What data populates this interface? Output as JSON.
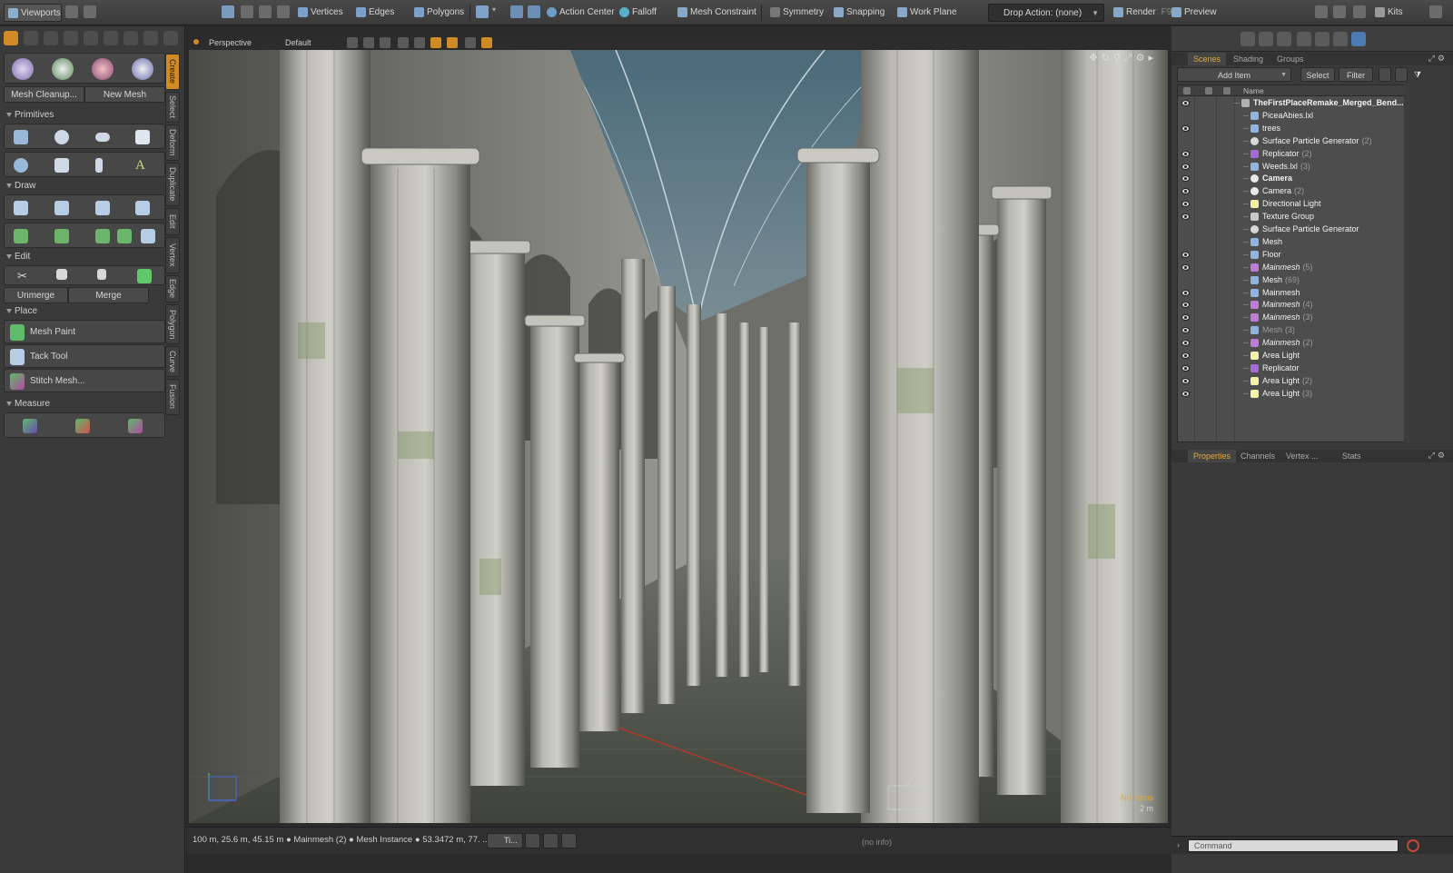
{
  "topbar": {
    "viewports_label": "Viewports",
    "vertices_label": "Vertices",
    "edges_label": "Edges",
    "polygons_label": "Polygons",
    "action_center_label": "Action Center",
    "falloff_label": "Falloff",
    "mesh_constraint_label": "Mesh Constraint",
    "symmetry_label": "Symmetry",
    "snapping_label": "Snapping",
    "work_plane_label": "Work Plane",
    "drop_action_label": "Drop Action: (none)",
    "render_label": "Render",
    "render_shortcut": "F9",
    "preview_label": "Preview",
    "kits_label": "Kits"
  },
  "toolbox": {
    "mesh_cleanup": "Mesh Cleanup...",
    "new_mesh": "New Mesh",
    "sections": {
      "primitives": "Primitives",
      "draw": "Draw",
      "edit": "Edit",
      "place": "Place",
      "measure": "Measure"
    },
    "unmerge": "Unmerge",
    "merge": "Merge",
    "place_tools": [
      "Mesh Paint",
      "Tack Tool",
      "Stitch Mesh..."
    ],
    "side_tabs": [
      "Create",
      "Select",
      "Deform",
      "Duplicate",
      "Edit",
      "Vertex",
      "Edge",
      "Polygon",
      "Curve",
      "Fusion"
    ]
  },
  "viewport": {
    "projection": "Perspective",
    "style": "Default",
    "info_items": "No Items",
    "scale": "2 m"
  },
  "status": {
    "text": "100 m, 25.6 m, 45.15 m ● Mainmesh (2) ● Mesh Instance ● 53.3472 m, 77. ...",
    "timeline_label": "Ti...",
    "no_info": "(no info)"
  },
  "scenes": {
    "tabs": [
      "Scenes",
      "Shading",
      "Groups"
    ],
    "add_item": "Add Item",
    "select": "Select",
    "filter": "Filter",
    "col_name": "Name",
    "items": [
      {
        "label": "TheFirstPlaceRemake_Merged_Bend...",
        "count": "",
        "icon": "scene",
        "style": "bold",
        "level": 0,
        "visible": true
      },
      {
        "label": "PiceaAbies.lxl",
        "count": "",
        "icon": "mesh",
        "style": "normal",
        "level": 1,
        "visible": false
      },
      {
        "label": "trees",
        "count": "",
        "icon": "mesh",
        "style": "normal",
        "level": 1,
        "visible": true
      },
      {
        "label": "Surface Particle Generator",
        "count": "(2)",
        "icon": "gen",
        "style": "normal",
        "level": 1,
        "visible": false
      },
      {
        "label": "Replicator",
        "count": "(2)",
        "icon": "rep",
        "style": "normal",
        "level": 1,
        "visible": true
      },
      {
        "label": "Weeds.lxl",
        "count": "(3)",
        "icon": "mesh",
        "style": "normal",
        "level": 1,
        "visible": true
      },
      {
        "label": "Camera",
        "count": "",
        "icon": "cam",
        "style": "bold",
        "level": 1,
        "visible": true
      },
      {
        "label": "Camera",
        "count": "(2)",
        "icon": "cam",
        "style": "normal",
        "level": 1,
        "visible": true
      },
      {
        "label": "Directional Light",
        "count": "",
        "icon": "dlight",
        "style": "normal",
        "level": 1,
        "visible": true
      },
      {
        "label": "Texture Group",
        "count": "",
        "icon": "tex",
        "style": "normal",
        "level": 1,
        "visible": true
      },
      {
        "label": "Surface Particle Generator",
        "count": "",
        "icon": "gen",
        "style": "normal",
        "level": 1,
        "visible": false
      },
      {
        "label": "Mesh",
        "count": "",
        "icon": "mesh",
        "style": "normal",
        "level": 1,
        "visible": false
      },
      {
        "label": "Floor",
        "count": "",
        "icon": "mesh",
        "style": "normal",
        "level": 1,
        "visible": true
      },
      {
        "label": "Mainmesh",
        "count": "(5)",
        "icon": "inst",
        "style": "italic",
        "level": 1,
        "visible": true
      },
      {
        "label": "Mesh",
        "count": "(69)",
        "icon": "mesh",
        "style": "normal",
        "level": 1,
        "visible": false
      },
      {
        "label": "Mainmesh",
        "count": "",
        "icon": "mesh",
        "style": "normal",
        "level": 1,
        "visible": true
      },
      {
        "label": "Mainmesh",
        "count": "(4)",
        "icon": "inst",
        "style": "italic",
        "level": 1,
        "visible": true
      },
      {
        "label": "Mainmesh",
        "count": "(3)",
        "icon": "inst",
        "style": "italic",
        "level": 1,
        "visible": true
      },
      {
        "label": "Mesh",
        "count": "(3)",
        "icon": "mesh",
        "style": "dim",
        "level": 1,
        "visible": true
      },
      {
        "label": "Mainmesh",
        "count": "(2)",
        "icon": "inst",
        "style": "italic",
        "level": 1,
        "visible": true
      },
      {
        "label": "Area Light",
        "count": "",
        "icon": "alight",
        "style": "normal",
        "level": 1,
        "visible": true
      },
      {
        "label": "Replicator",
        "count": "",
        "icon": "rep",
        "style": "normal",
        "level": 1,
        "visible": true
      },
      {
        "label": "Area Light",
        "count": "(2)",
        "icon": "alight",
        "style": "normal",
        "level": 1,
        "visible": true
      },
      {
        "label": "Area Light",
        "count": "(3)",
        "icon": "alight",
        "style": "normal",
        "level": 1,
        "visible": true
      }
    ]
  },
  "properties": {
    "tabs": [
      "Properties",
      "Channels",
      "Vertex ...",
      "Stats"
    ]
  },
  "command": {
    "placeholder": "Command"
  },
  "colors": {
    "accent": "#d08a26",
    "highlight_text": "#e0a83a"
  }
}
